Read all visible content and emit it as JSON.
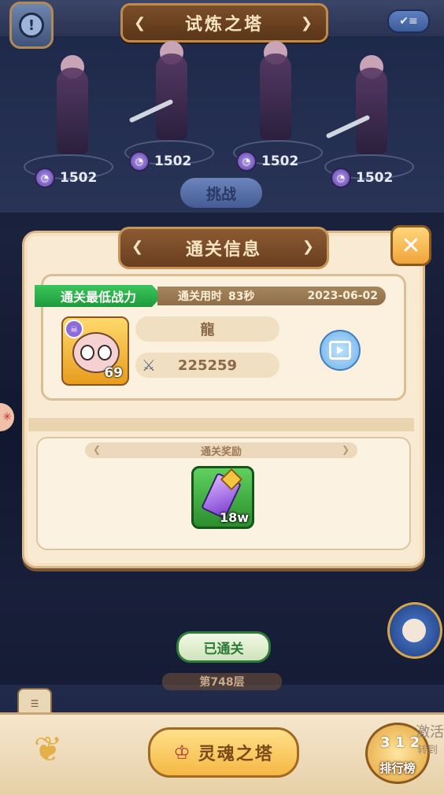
{
  "header": {
    "title": "试炼之塔",
    "info_icon": "info-icon",
    "checklist_icon": "checklist-icon"
  },
  "stage": {
    "enemies": [
      {
        "power": "1502"
      },
      {
        "power": "1502"
      },
      {
        "power": "1502"
      },
      {
        "power": "1502"
      }
    ],
    "challenge_label": "挑战"
  },
  "modal": {
    "title": "通关信息",
    "close_icon": "close-icon",
    "lowest_power_tag": "通关最低战力",
    "clear_time_label": "通关用时",
    "clear_time_value": "83秒",
    "clear_date": "2023-06-02",
    "player": {
      "name": "龍",
      "level": "69",
      "power": "225259"
    },
    "replay_icon": "replay-video-icon",
    "reward_title": "通关奖励",
    "reward_qty": "18w"
  },
  "lower": {
    "passed_label": "已通关",
    "floor_label": "第748层"
  },
  "bottom_bar": {
    "soul_tower_label": "灵魂之塔",
    "rank_label": "排行榜",
    "rank_podium": "3 1 2",
    "side_text": "激活",
    "side_text2": "转到"
  },
  "colors": {
    "accent_green": "#1f9a3d",
    "modal_bg": "#f8ead3",
    "title_brown": "#6a3e1f"
  }
}
